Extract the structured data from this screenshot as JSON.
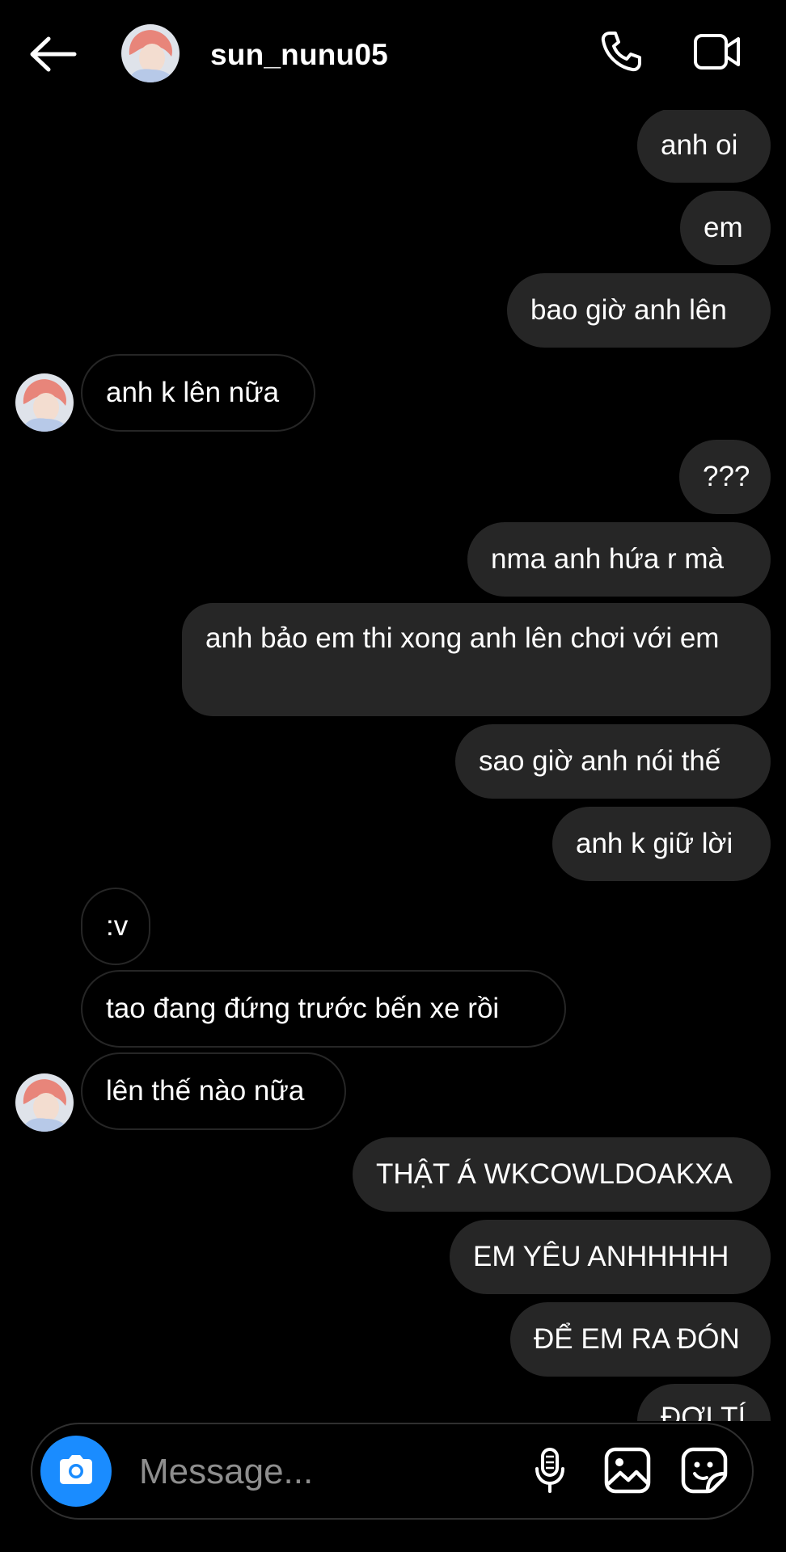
{
  "header": {
    "username": "sun_nunu05",
    "back_icon": "arrow-left-icon",
    "call_icon": "phone-icon",
    "video_icon": "video-camera-icon",
    "avatar_colors": {
      "hair": "#e8857a",
      "skin": "#f3ddd0",
      "shirt": "#b7c9e8"
    }
  },
  "messages": [
    {
      "side": "sent",
      "text": "anh oi"
    },
    {
      "side": "sent",
      "text": "em"
    },
    {
      "side": "sent",
      "text": "bao giờ anh lên"
    },
    {
      "side": "received",
      "text": "anh k lên nữa"
    },
    {
      "side": "sent",
      "text": "???"
    },
    {
      "side": "sent",
      "text": "nma anh hứa r mà"
    },
    {
      "side": "sent",
      "text": "anh bảo em thi xong anh lên chơi với em"
    },
    {
      "side": "sent",
      "text": "sao giờ anh nói thế"
    },
    {
      "side": "sent",
      "text": "anh k giữ lời"
    },
    {
      "side": "received",
      "text": ":v"
    },
    {
      "side": "received",
      "text": "tao đang đứng trước bến xe rồi"
    },
    {
      "side": "received",
      "text": "lên thế nào nữa"
    },
    {
      "side": "sent",
      "text": "THẬT Á WKCOWLDOAKXA"
    },
    {
      "side": "sent",
      "text": "EM YÊU ANHHHHH"
    },
    {
      "side": "sent",
      "text": "ĐỂ EM RA ĐÓN"
    },
    {
      "side": "sent",
      "text": "ĐỢI TÍ"
    }
  ],
  "composer": {
    "placeholder": "Message...",
    "camera_icon": "camera-icon",
    "mic_icon": "microphone-icon",
    "gallery_icon": "image-gallery-icon",
    "sticker_icon": "sticker-icon",
    "accent_color": "#1a8cff"
  },
  "colors": {
    "background": "#000000",
    "sent_bubble": "#262626",
    "received_border": "#262626",
    "text": "#ffffff",
    "placeholder": "#8e8e8e"
  }
}
